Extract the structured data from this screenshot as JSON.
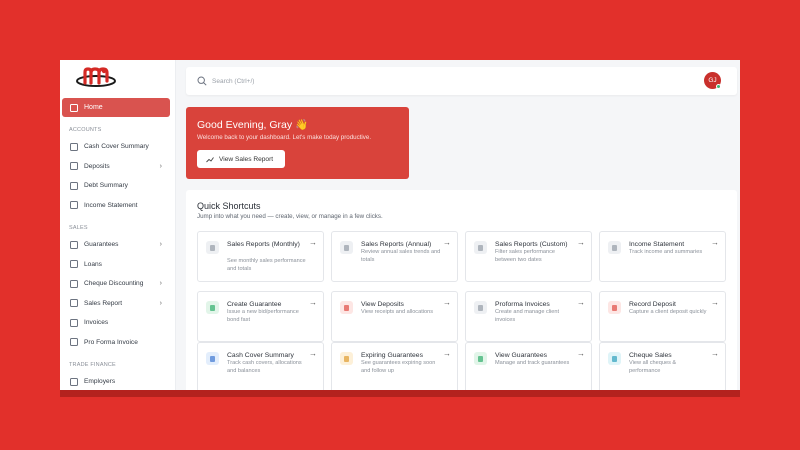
{
  "sidebar": {
    "home": "Home",
    "sections": [
      {
        "title": "ACCOUNTS",
        "items": [
          {
            "label": "Cash Cover Summary",
            "icon": "lock-icon",
            "chevron": false
          },
          {
            "label": "Deposits",
            "icon": "document-icon",
            "chevron": true
          },
          {
            "label": "Debt Summary",
            "icon": "list-icon",
            "chevron": false
          },
          {
            "label": "Income Statement",
            "icon": "camera-icon",
            "chevron": false
          }
        ]
      },
      {
        "title": "SALES",
        "items": [
          {
            "label": "Guarantees",
            "icon": "shield-icon",
            "chevron": true
          },
          {
            "label": "Loans",
            "icon": "receipt-icon",
            "chevron": false
          },
          {
            "label": "Cheque Discounting",
            "icon": "cheque-icon",
            "chevron": true
          },
          {
            "label": "Sales Report",
            "icon": "chart-icon",
            "chevron": true
          },
          {
            "label": "Invoices",
            "icon": "invoice-icon",
            "chevron": false
          },
          {
            "label": "Pro Forma Invoice",
            "icon": "file-icon",
            "chevron": false
          }
        ]
      },
      {
        "title": "TRADE FINANCE",
        "items": [
          {
            "label": "Employers",
            "icon": "building-icon",
            "chevron": false
          }
        ]
      }
    ]
  },
  "topbar": {
    "search_placeholder": "Search (Ctrl+/)",
    "avatar_initials": "GJ"
  },
  "greeting": {
    "title": "Good Evening, Gray 👋",
    "subtitle": "Welcome back to your dashboard. Let's make today productive.",
    "button": "View Sales Report"
  },
  "shortcuts": {
    "title": "Quick Shortcuts",
    "subtitle": "Jump into what you need — create, view, or manage in a few clicks.",
    "cards": [
      {
        "title": "Sales Reports (Monthly)",
        "desc": "See monthly sales performance and totals",
        "color": "gray"
      },
      {
        "title": "Sales Reports (Annual)",
        "desc": "Review annual sales trends and totals",
        "color": "gray"
      },
      {
        "title": "Sales Reports (Custom)",
        "desc": "Filter sales performance between two dates",
        "color": "gray"
      },
      {
        "title": "Income Statement",
        "desc": "Track income and summaries",
        "color": "gray"
      },
      {
        "title": "Create Guarantee",
        "desc": "Issue a new bid/performance bond fast",
        "color": "green"
      },
      {
        "title": "View Deposits",
        "desc": "View receipts and allocations",
        "color": "red"
      },
      {
        "title": "Proforma Invoices",
        "desc": "Create and manage client invoices",
        "color": "gray"
      },
      {
        "title": "Record Deposit",
        "desc": "Capture a client deposit quickly",
        "color": "red"
      },
      {
        "title": "Cash Cover Summary",
        "desc": "Track cash covers, allocations and balances",
        "color": "blue"
      },
      {
        "title": "Expiring Guarantees",
        "desc": "See guarantees expiring soon and follow up",
        "color": "yellow"
      },
      {
        "title": "View Guarantees",
        "desc": "Manage and track guarantees",
        "color": "green"
      },
      {
        "title": "Cheque Sales",
        "desc": "View all cheques & performance",
        "color": "cyan"
      }
    ]
  },
  "colors": {
    "brand": "#e2302b",
    "accent": "#d9433b",
    "online": "#3bb273"
  }
}
